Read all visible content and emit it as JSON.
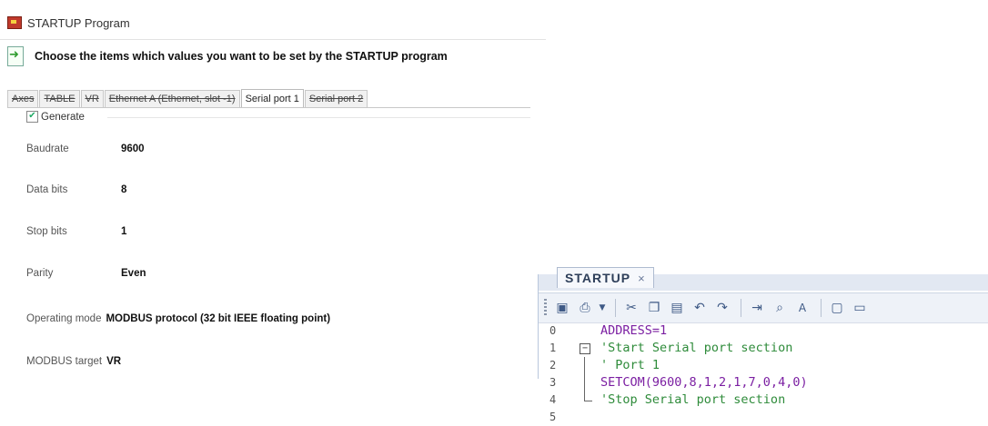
{
  "dialog": {
    "title": "STARTUP Program",
    "header": "Choose the items which values you want to be set by the STARTUP program",
    "tabs": [
      "Axes",
      "TABLE",
      "VR",
      "Ethernet A (Ethernet, slot -1)",
      "Serial port 1",
      "Serial port 2"
    ],
    "active_tab": "Serial port 1",
    "generate_label": "Generate",
    "generate_checked": true,
    "fields": [
      {
        "label": "Baudrate",
        "value": "9600"
      },
      {
        "label": "Data bits",
        "value": "8"
      },
      {
        "label": "Stop bits",
        "value": "1"
      },
      {
        "label": "Parity",
        "value": "Even"
      },
      {
        "label": "Operating mode",
        "value": "MODBUS protocol (32 bit IEEE floating point)"
      },
      {
        "label": "MODBUS target",
        "value": "VR"
      }
    ]
  },
  "editor": {
    "tab_title": "STARTUP",
    "tab_close": "×",
    "toolbar_icons": [
      "save-icon",
      "print-icon",
      "dropdown-icon",
      "cut-icon",
      "copy-icon",
      "paste-icon",
      "undo-icon",
      "redo-icon",
      "indent-icon",
      "find-icon",
      "font-icon",
      "window-icon",
      "comment-icon"
    ],
    "lines": [
      {
        "num": "0",
        "text": "ADDRESS=1",
        "color": "purple"
      },
      {
        "num": "1",
        "text": "'Start Serial port section",
        "color": "green"
      },
      {
        "num": "2",
        "text": "' Port 1",
        "color": "green"
      },
      {
        "num": "3",
        "text": "SETCOM(9600,8,1,2,1,7,0,4,0)",
        "color": "purple"
      },
      {
        "num": "4",
        "text": "'Stop Serial port section",
        "color": "green"
      },
      {
        "num": "5",
        "text": "",
        "color": "dark"
      }
    ]
  },
  "colors": {
    "comment": "#2e8b3a",
    "keyword": "#7b1fa2",
    "toolbar_bg": "#eef2f8"
  }
}
